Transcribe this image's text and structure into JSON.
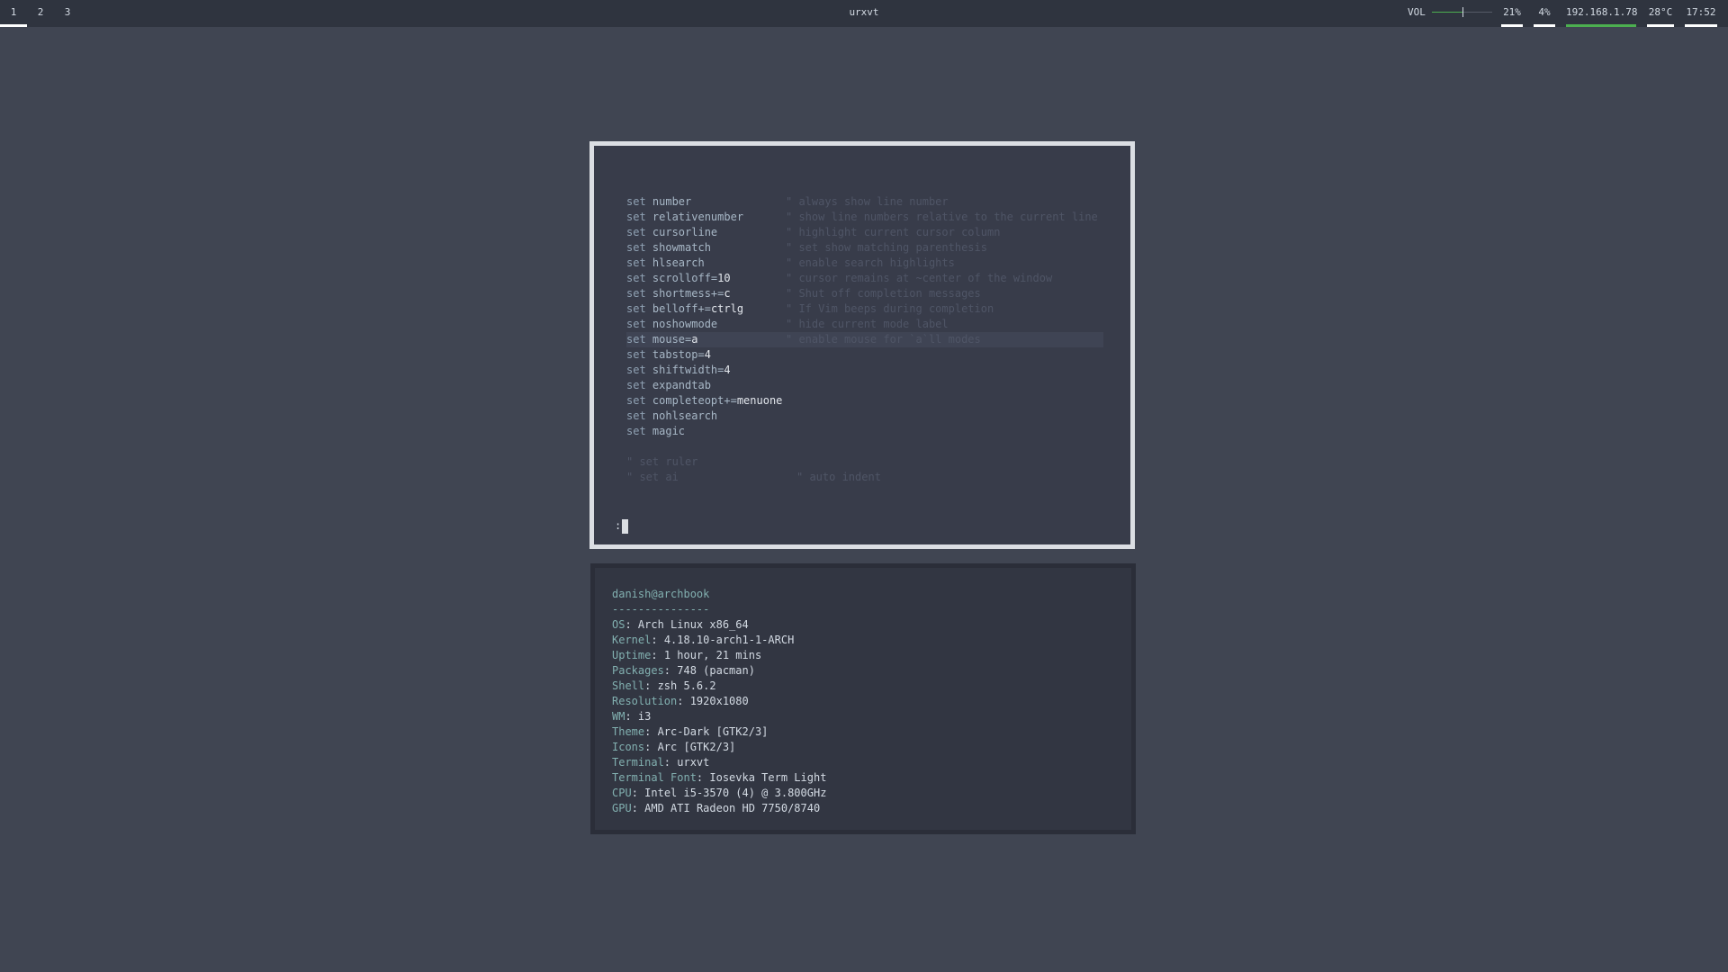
{
  "bar": {
    "workspaces": [
      {
        "label": "1",
        "active": true
      },
      {
        "label": "2",
        "active": false
      },
      {
        "label": "3",
        "active": false
      }
    ],
    "window_title": "urxvt",
    "volume": {
      "label": "VOL",
      "level_percent": 50
    },
    "cpu": "21%",
    "memory": "4%",
    "ip": "192.168.1.78",
    "temperature": "28°C",
    "clock": "17:52",
    "colors": {
      "accent_green": "#4caf50",
      "underline": "#ffffff"
    }
  },
  "vim": {
    "lines": [
      {
        "kw": "set",
        "opt": "number",
        "val": "",
        "comment": "\" always show line number"
      },
      {
        "kw": "set",
        "opt": "relativenumber",
        "val": "",
        "comment": "\" show line numbers relative to the current line"
      },
      {
        "kw": "set",
        "opt": "cursorline",
        "val": "",
        "comment": "\" highlight current cursor column"
      },
      {
        "kw": "set",
        "opt": "showmatch",
        "val": "",
        "comment": "\" set show matching parenthesis"
      },
      {
        "kw": "set",
        "opt": "hlsearch",
        "val": "",
        "comment": "\" enable search highlights"
      },
      {
        "kw": "set",
        "opt": "scrolloff=",
        "val": "10",
        "comment": "\" cursor remains at ~center of the window"
      },
      {
        "kw": "set",
        "opt": "shortmess+=",
        "val": "c",
        "comment": "\" Shut off completion messages"
      },
      {
        "kw": "set",
        "opt": "belloff+=",
        "val": "ctrlg",
        "comment": "\" If Vim beeps during completion"
      },
      {
        "kw": "set",
        "opt": "noshowmode",
        "val": "",
        "comment": "\" hide current mode label"
      },
      {
        "kw": "set",
        "opt": "mouse=",
        "val": "a",
        "comment": "\" enable mouse for `a`ll modes"
      },
      {
        "kw": "set",
        "opt": "tabstop=",
        "val": "4",
        "comment": ""
      },
      {
        "kw": "set",
        "opt": "shiftwidth=",
        "val": "4",
        "comment": ""
      },
      {
        "kw": "set",
        "opt": "expandtab",
        "val": "",
        "comment": ""
      },
      {
        "kw": "set",
        "opt": "completeopt+=",
        "val": "menuone",
        "comment": ""
      },
      {
        "kw": "set",
        "opt": "nohlsearch",
        "val": "",
        "comment": ""
      },
      {
        "kw": "set",
        "opt": "magic",
        "val": "",
        "comment": ""
      }
    ],
    "commented": [
      {
        "text": "\" set ruler",
        "comment": ""
      },
      {
        "text": "\" set ai",
        "comment": "\" auto indent"
      }
    ],
    "cursorline_index": 9,
    "cmdline": ":"
  },
  "neofetch": {
    "title": "danish@archbook",
    "separator": "---------------",
    "fields": [
      {
        "key": "OS",
        "value": "Arch Linux x86_64"
      },
      {
        "key": "Kernel",
        "value": "4.18.10-arch1-1-ARCH"
      },
      {
        "key": "Uptime",
        "value": "1 hour, 21 mins"
      },
      {
        "key": "Packages",
        "value": "748 (pacman)"
      },
      {
        "key": "Shell",
        "value": "zsh 5.6.2"
      },
      {
        "key": "Resolution",
        "value": "1920x1080"
      },
      {
        "key": "WM",
        "value": "i3"
      },
      {
        "key": "Theme",
        "value": "Arc-Dark [GTK2/3]"
      },
      {
        "key": "Icons",
        "value": "Arc [GTK2/3]"
      },
      {
        "key": "Terminal",
        "value": "urxvt"
      },
      {
        "key": "Terminal Font",
        "value": "Iosevka Term Light"
      },
      {
        "key": "CPU",
        "value": "Intel i5-3570 (4) @ 3.800GHz"
      },
      {
        "key": "GPU",
        "value": "AMD ATI Radeon HD 7750/8740"
      }
    ]
  }
}
